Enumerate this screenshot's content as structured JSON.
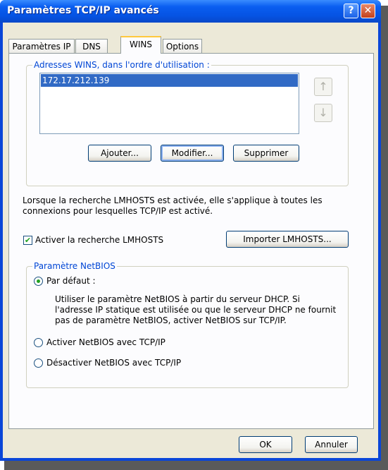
{
  "window": {
    "title": "Paramètres TCP/IP avancés",
    "help_label": "?",
    "close_label": "✕"
  },
  "tabs": [
    {
      "label": "Paramètres IP"
    },
    {
      "label": "DNS"
    },
    {
      "label": "WINS",
      "active": true
    },
    {
      "label": "Options"
    }
  ],
  "wins": {
    "group_title": "Adresses WINS, dans l'ordre d'utilisation :",
    "addresses": [
      "172.17.212.139"
    ],
    "up_glyph": "↑",
    "down_glyph": "↓",
    "add_label": "Ajouter...",
    "edit_label": "Modifier...",
    "remove_label": "Supprimer"
  },
  "lmhosts": {
    "description": "Lorsque la recherche LMHOSTS est activée, elle s'applique à toutes les connexions pour lesquelles TCP/IP est activé.",
    "enable_label": "Activer la recherche LMHOSTS",
    "enable_checked": true,
    "import_label": "Importer LMHOSTS..."
  },
  "netbios": {
    "group_title": "Paramètre NetBIOS",
    "default_label": "Par défaut :",
    "default_desc": "Utiliser le paramètre NetBIOS à partir du serveur DHCP. Si l'adresse IP statique est utilisée ou que le serveur DHCP ne fournit pas de paramètre NetBIOS, activer NetBIOS sur TCP/IP.",
    "enable_label": "Activer NetBIOS avec TCP/IP",
    "disable_label": "Désactiver NetBIOS avec TCP/IP",
    "selected": "default"
  },
  "footer": {
    "ok_label": "OK",
    "cancel_label": "Annuler"
  },
  "colors": {
    "title_bar": "#0553e3",
    "selection": "#316ac5",
    "group_title": "#0046d5",
    "check_green": "#21a121"
  }
}
